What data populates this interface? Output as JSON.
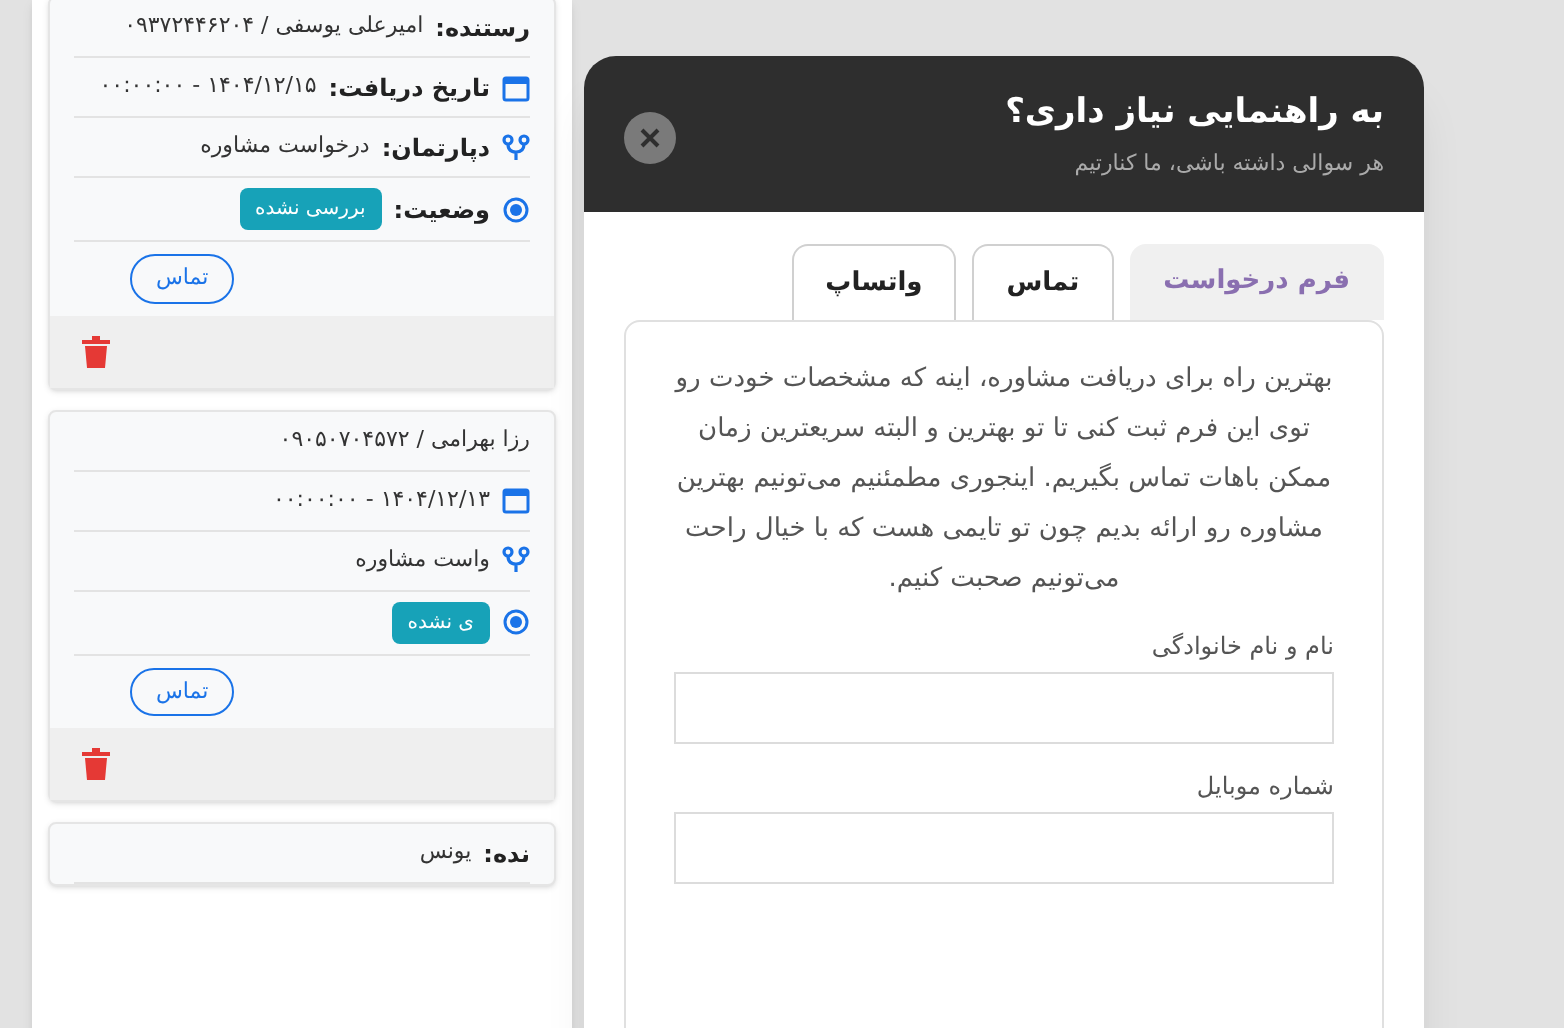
{
  "requests": [
    {
      "fields": [
        {
          "kind": "sender",
          "label": "رستنده:",
          "value": "امیرعلی یوسفی / ۰۹۳۷۲۴۴۶۲۰۴"
        },
        {
          "kind": "date",
          "label": "تاریخ دریافت:",
          "value": "۱۴۰۴/۱۲/۱۵ - ۰۰:۰۰:۰۰"
        },
        {
          "kind": "department",
          "label": "دپارتمان:",
          "value": "درخواست مشاوره"
        },
        {
          "kind": "status",
          "label": "وضعیت:",
          "value": "بررسی نشده"
        }
      ],
      "call_button": "تماس"
    },
    {
      "fields": [
        {
          "kind": "sender",
          "value": "رزا بهرامی / ۰۹۰۵۰۷۰۴۵۷۲"
        },
        {
          "kind": "date",
          "value": "۱۴۰۴/۱۲/۱۳ - ۰۰:۰۰:۰۰"
        },
        {
          "kind": "department",
          "value": "واست مشاوره"
        },
        {
          "kind": "status",
          "value": "ی نشده"
        }
      ],
      "call_button": "تماس"
    },
    {
      "fields": [
        {
          "kind": "sender",
          "label": "نده:",
          "value": "یونس"
        }
      ]
    }
  ],
  "help_modal": {
    "title": "به راهنمایی نیاز داری؟",
    "subtitle": "هر سوالی داشته باشی، ما کنارتیم",
    "tabs": [
      {
        "label": "فرم درخواست",
        "selected": true
      },
      {
        "label": "تماس",
        "selected": false
      },
      {
        "label": "واتساپ",
        "selected": false
      }
    ],
    "intro": "بهترین راه برای دریافت مشاوره، اینه که مشخصات خودت رو توی این فرم ثبت کنی تا تو بهترین و البته سریعترین زمان ممکن باهات تماس بگیریم. اینجوری مطمئنیم می‌تونیم بهترین مشاوره رو ارائه بدیم چون تو تایمی هست که با خیال راحت می‌تونیم صحبت کنیم.",
    "fields": [
      {
        "label": "نام و نام خانوادگی"
      },
      {
        "label": "شماره موبایل"
      }
    ]
  }
}
